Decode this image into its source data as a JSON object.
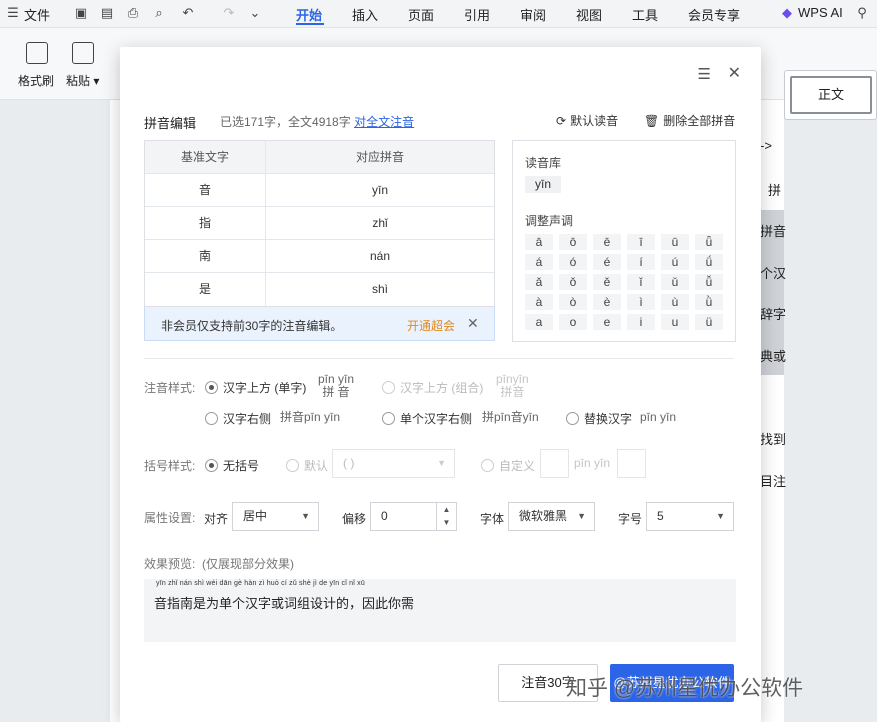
{
  "menubar": {
    "file": "文件",
    "tabs": [
      "开始",
      "插入",
      "页面",
      "引用",
      "审阅",
      "视图",
      "工具",
      "会员专享"
    ],
    "active_tab": "开始",
    "wps_ai": "WPS AI"
  },
  "ribbon": {
    "format_painter": "格式刷",
    "paste": "粘贴",
    "style_normal": "正文"
  },
  "doc_side": [
    "->",
    "拼",
    "拼音",
    "个汉",
    "辞字",
    "典或",
    "找到",
    "目注"
  ],
  "dialog": {
    "title": "拼音编辑",
    "selected_info": "已选171字，全文4918字",
    "full_text_link": "对全文注音",
    "default_reading": "默认读音",
    "delete_all": "删除全部拼音",
    "table": {
      "headers": [
        "基准文字",
        "对应拼音"
      ],
      "rows": [
        {
          "char": "音",
          "pinyin": "yīn"
        },
        {
          "char": "指",
          "pinyin": "zhǐ"
        },
        {
          "char": "南",
          "pinyin": "nán"
        },
        {
          "char": "是",
          "pinyin": "shì"
        }
      ]
    },
    "notice": {
      "text": "非会员仅支持前30字的注音编辑。",
      "link": "开通超会"
    },
    "reading_lib": {
      "label": "读音库",
      "chip": "yīn",
      "tone_label": "调整声调",
      "tones": [
        [
          "ā",
          "ō",
          "ē",
          "ī",
          "ū",
          "ǖ"
        ],
        [
          "á",
          "ó",
          "é",
          "í",
          "ú",
          "ǘ"
        ],
        [
          "ǎ",
          "ǒ",
          "ě",
          "ǐ",
          "ǔ",
          "ǚ"
        ],
        [
          "à",
          "ò",
          "è",
          "ì",
          "ù",
          "ǜ"
        ],
        [
          "a",
          "o",
          "e",
          "i",
          "u",
          "ü"
        ]
      ]
    },
    "annotation_style": {
      "label": "注音样式:",
      "above_single": "汉字上方 (单字)",
      "above_single_sample_py": "pīn yīn",
      "above_single_sample_hz": "拼 音",
      "above_group": "汉字上方 (组合)",
      "above_group_sample_py": "pīnyīn",
      "above_group_sample_hz": "拼音",
      "right_side": "汉字右侧",
      "right_side_sample": "拼音pīn yīn",
      "single_right": "单个汉字右侧",
      "single_right_sample": "拼pīn音yīn",
      "replace": "替换汉字",
      "replace_sample": "pīn yīn"
    },
    "bracket_style": {
      "label": "括号样式:",
      "none": "无括号",
      "default": "默认",
      "default_value": "( )",
      "custom": "自定义",
      "custom_sample": "pīn yīn"
    },
    "properties": {
      "label": "属性设置:",
      "align_label": "对齐",
      "align_value": "居中",
      "offset_label": "偏移",
      "offset_value": "0",
      "font_label": "字体",
      "font_value": "微软雅黑",
      "size_label": "字号",
      "size_value": "5"
    },
    "preview": {
      "label": "效果预览:",
      "note": "(仅展现部分效果)",
      "pinyin_line": "yīn zhǐ nán shì wéi dān gè hàn zì huò cí zǔ shè jì de    yīn cǐ nǐ xū",
      "text": "音指南是为单个汉字或词组设计的，因此你需"
    },
    "buttons": {
      "apply_30": "注音30字",
      "open_vip": "@苏州星优办公软件"
    }
  },
  "watermark": "知乎 @苏州星优办公软件"
}
